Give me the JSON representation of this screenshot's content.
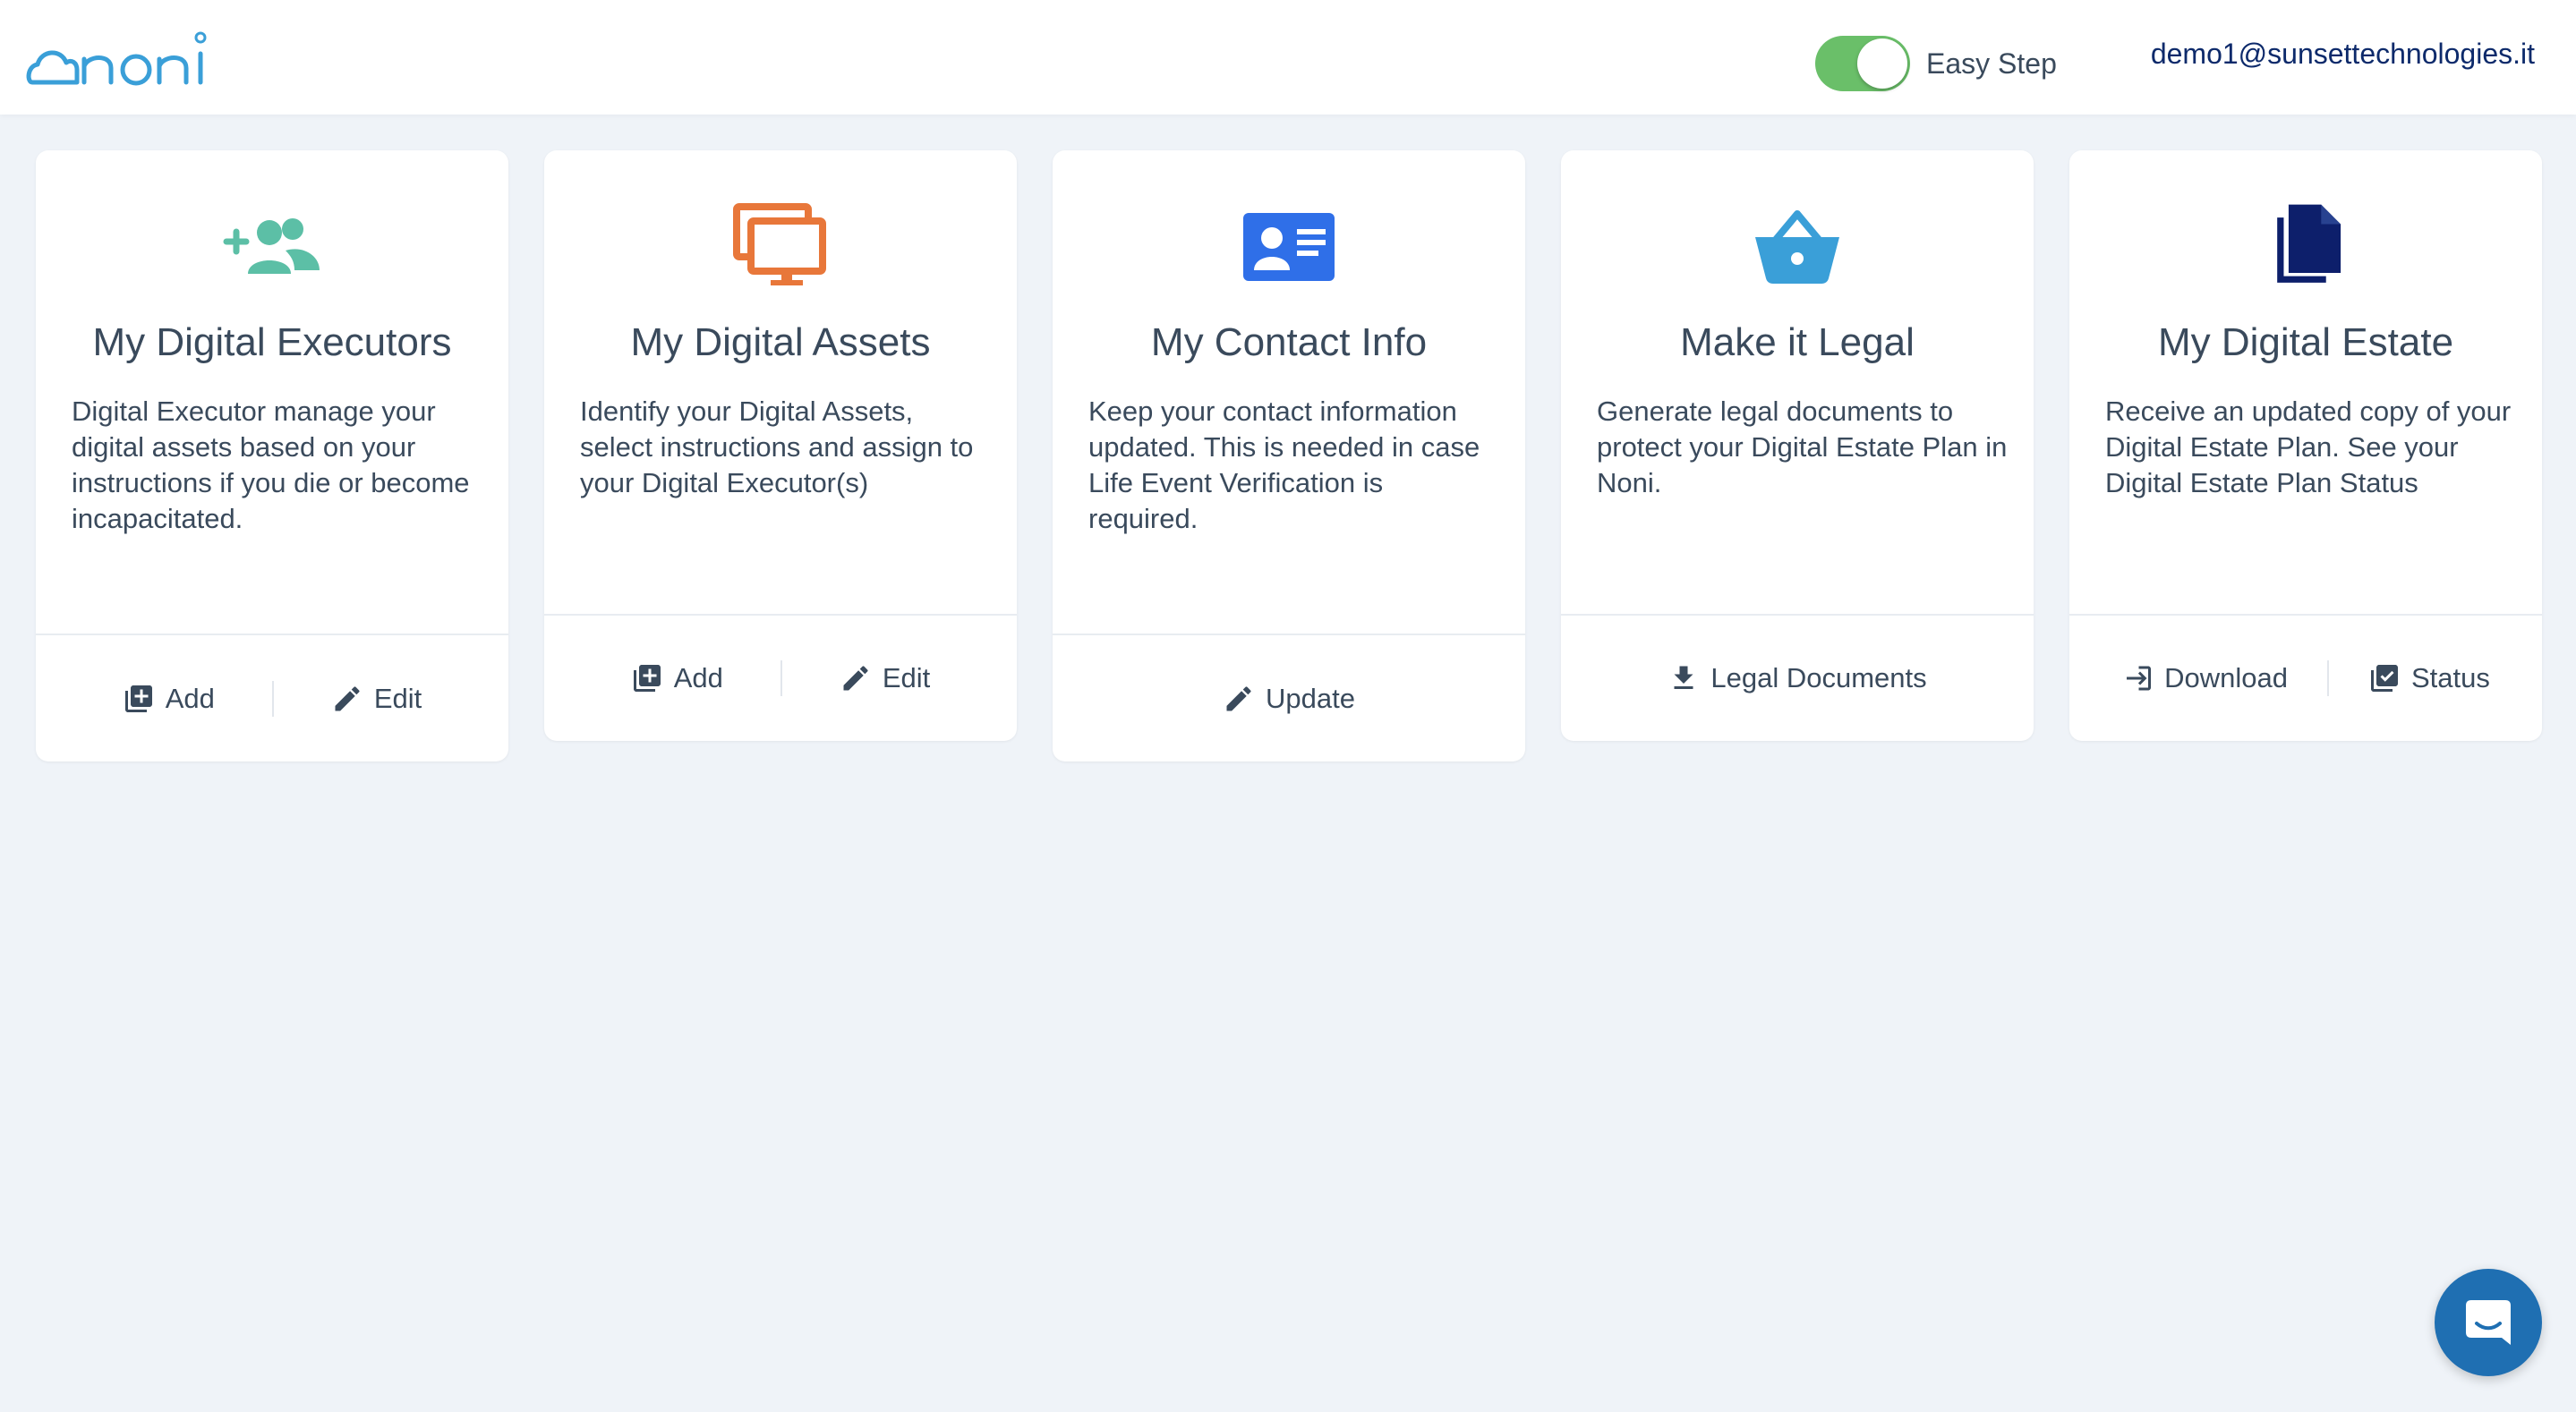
{
  "header": {
    "logo_text": "noni",
    "easy_step_label": "Easy Step",
    "easy_step_on": true,
    "user_email": "demo1@sunsettechnologies.it"
  },
  "colors": {
    "logo": "#3a9fd8",
    "toggle_on": "#6abf69",
    "executors_icon": "#5cbfa6",
    "assets_icon": "#e8773a",
    "contact_icon": "#2f6fe8",
    "legal_icon": "#3a9fd8",
    "estate_icon": "#0d1f6b",
    "chat_button": "#1f6fb2"
  },
  "cards": [
    {
      "icon": "add-people-icon",
      "title": "My Digital Executors",
      "description": "Digital Executor manage your digital assets based on your instructions if you die or become incapacitated.",
      "actions": [
        {
          "icon": "add-box-icon",
          "label": "Add"
        },
        {
          "icon": "pencil-icon",
          "label": "Edit"
        }
      ]
    },
    {
      "icon": "monitors-icon",
      "title": "My Digital Assets",
      "description": "Identify your Digital Assets, select instructions and assign to your Digital Executor(s)",
      "actions": [
        {
          "icon": "add-box-icon",
          "label": "Add"
        },
        {
          "icon": "pencil-icon",
          "label": "Edit"
        }
      ]
    },
    {
      "icon": "contact-card-icon",
      "title": "My Contact Info",
      "description": "Keep your contact information updated. This is needed in case Life Event Verification is required.",
      "actions": [
        {
          "icon": "pencil-icon",
          "label": "Update"
        }
      ]
    },
    {
      "icon": "basket-icon",
      "title": "Make it Legal",
      "description": "Generate legal documents to protect your Digital Estate Plan in Noni.",
      "actions": [
        {
          "icon": "download-arrow-icon",
          "label": "Legal Documents"
        }
      ]
    },
    {
      "icon": "documents-icon",
      "title": "My Digital Estate",
      "description": "Receive an updated copy of your Digital Estate Plan. See your Digital Estate Plan Status",
      "actions": [
        {
          "icon": "sign-in-icon",
          "label": "Download"
        },
        {
          "icon": "checked-box-icon",
          "label": "Status"
        }
      ]
    }
  ],
  "chat": {
    "icon": "chat-bubble-icon"
  }
}
